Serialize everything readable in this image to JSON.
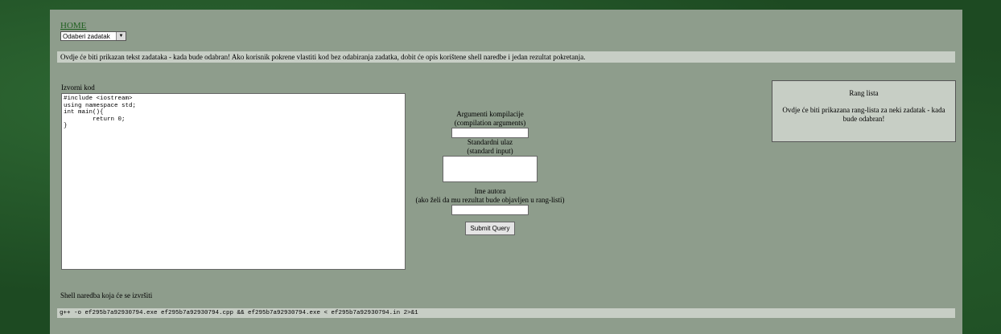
{
  "nav": {
    "home": "HOME"
  },
  "task_select": {
    "value": "Odaberi zadatak"
  },
  "task_text": "Ovdje će biti prikazan tekst zadataka - kada bude odabran! Ako korisnik pokrene vlastiti kod bez odabiranja zadatka, dobit će opis korištene shell naredbe i jedan rezultat pokretanja.",
  "source": {
    "label": "Izvorni kod",
    "code": "#include <iostream>\nusing namespace std;\nint main(){\n        return 0;\n}"
  },
  "form": {
    "compile_label": "Argumenti kompilacije",
    "compile_sub": "(compilation arguments)",
    "stdin_label": "Standardni ulaz",
    "stdin_sub": "(standard input)",
    "author_label": "Ime autora",
    "author_sub": "(ako želi da mu rezultat bude objavljen u rang-listi)",
    "submit": "Submit Query"
  },
  "ranking": {
    "title": "Rang lista",
    "text": "Ovdje će biti prikazana rang-lista za neki zadatak - kada bude odabran!"
  },
  "shell": {
    "label": "Shell naredba koja će se izvršiti",
    "command": "g++  -o ef295b7a92930794.exe ef295b7a92930794.cpp && ef295b7a92930794.exe < ef295b7a92930794.in 2>&1"
  }
}
